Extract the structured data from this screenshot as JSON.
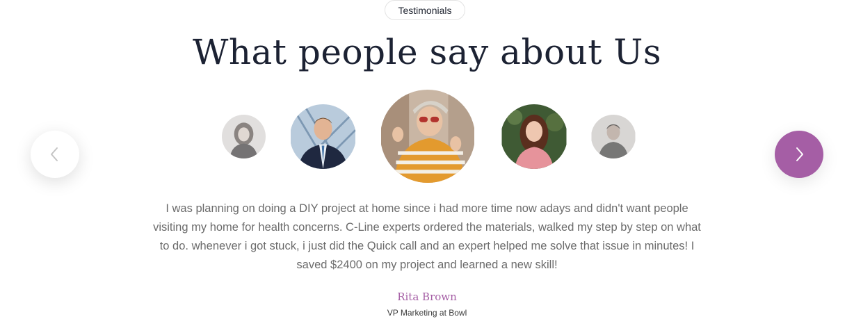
{
  "section": {
    "badge": "Testimonials",
    "title": "What people say about Us"
  },
  "carousel": {
    "prev_icon": "chevron-left-icon",
    "next_icon": "chevron-right-icon",
    "accent_color": "#a55ea5"
  },
  "testimonial": {
    "quote": "I was planning on doing a DIY project at home since i had more time now adays and didn't want people visiting my home for health concerns. C-Line experts ordered the materials, walked my step by step on what to do. whenever i got stuck, i just did the Quick call and an expert helped me solve that issue in minutes! I saved $2400 on my project and learned a new skill!",
    "name": "Rita Brown",
    "role": "VP Marketing at Bowl"
  }
}
